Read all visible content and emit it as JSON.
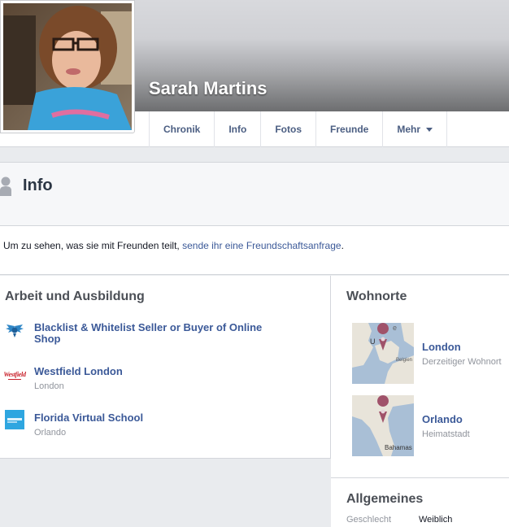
{
  "profile": {
    "name": "Sarah Martins"
  },
  "tabs": [
    {
      "label": "Chronik"
    },
    {
      "label": "Info"
    },
    {
      "label": "Fotos"
    },
    {
      "label": "Freunde"
    },
    {
      "label": "Mehr"
    }
  ],
  "info": {
    "title": "Info",
    "notice_text": "Um zu sehen, was sie mit Freunden teilt, ",
    "notice_link": "sende ihr eine Freundschaftsanfrage",
    "notice_end": "."
  },
  "work": {
    "title": "Arbeit und Ausbildung",
    "items": [
      {
        "name": "Blacklist & Whitelist Seller or Buyer of Online Shop",
        "sub": "",
        "logo": "winged-logo-icon"
      },
      {
        "name": "Westfield London",
        "sub": "London",
        "logo": "westfield-logo",
        "logo_text": "Westfield"
      },
      {
        "name": "Florida Virtual School",
        "sub": "Orlando",
        "logo": "florida-virtual-school-logo"
      }
    ]
  },
  "places": {
    "title": "Wohnorte",
    "items": [
      {
        "name": "London",
        "sub": "Derzeitiger Wohnort",
        "map_labels": [
          "U",
          "e",
          "Belgien"
        ]
      },
      {
        "name": "Orlando",
        "sub": "Heimatstadt",
        "map_labels": [
          "Bahamas"
        ]
      }
    ]
  },
  "general": {
    "title": "Allgemeines",
    "rows": [
      {
        "key": "Geschlecht",
        "value": "Weiblich"
      }
    ]
  },
  "colors": {
    "link": "#3b5998",
    "tab_text": "#4b5e82",
    "map_water": "#a9bfd6",
    "map_land": "#e8e4da",
    "pin": "#a0526a"
  }
}
